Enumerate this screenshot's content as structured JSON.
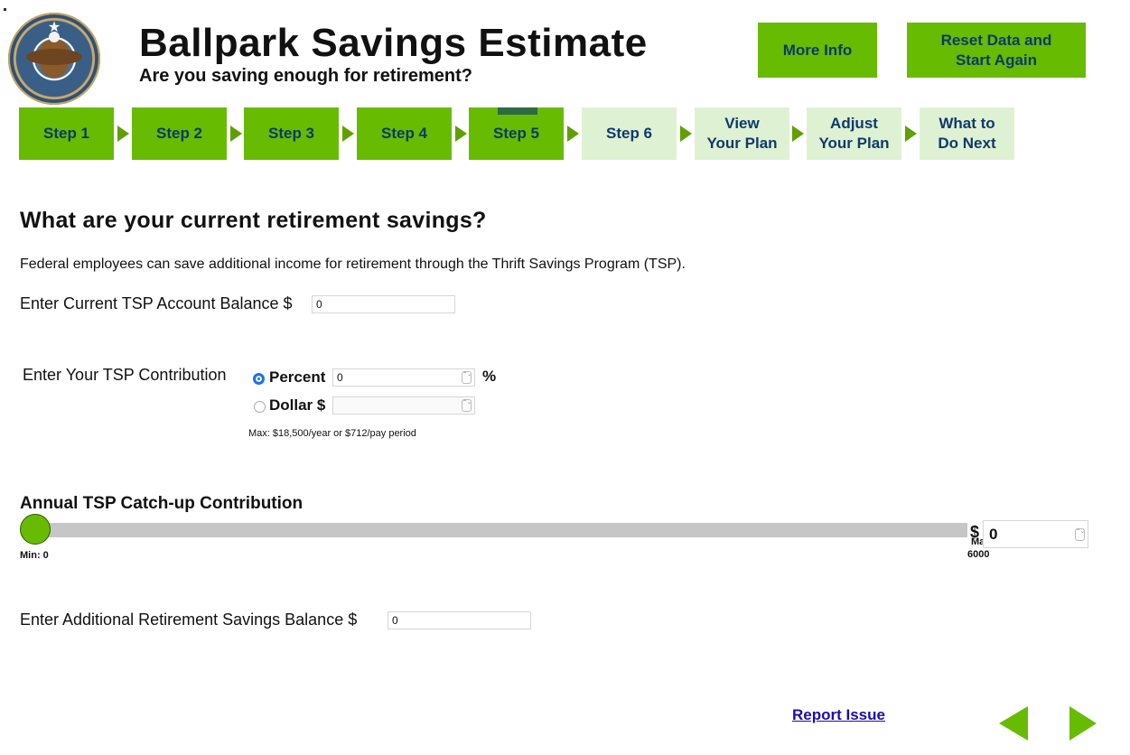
{
  "header": {
    "title": "Ballpark Savings Estimate",
    "subtitle": "Are you saving enough for retirement?",
    "more_info": "More Info",
    "reset": "Reset Data and Start Again"
  },
  "steps": [
    {
      "label": "Step 1",
      "state": "done"
    },
    {
      "label": "Step 2",
      "state": "done"
    },
    {
      "label": "Step 3",
      "state": "done"
    },
    {
      "label": "Step 4",
      "state": "done"
    },
    {
      "label": "Step 5",
      "state": "current"
    },
    {
      "label": "Step 6",
      "state": "todo"
    },
    {
      "label": "View Your Plan",
      "state": "todo"
    },
    {
      "label": "Adjust Your Plan",
      "state": "todo"
    },
    {
      "label": "What to Do Next",
      "state": "todo"
    }
  ],
  "main": {
    "heading": "What are your current retirement savings?",
    "intro": "Federal employees can save additional income for retirement through the Thrift Savings Program (TSP).",
    "tsp_balance_label": "Enter Current TSP Account Balance $",
    "tsp_balance_value": "0",
    "contribution_label": "Enter Your TSP Contribution",
    "percent_label": "Percent",
    "percent_value": "0",
    "percent_unit": "%",
    "dollar_label": "Dollar $",
    "dollar_value": "",
    "max_note": "Max: $18,500/year or $712/pay period",
    "catchup_heading": "Annual TSP Catch-up Contribution",
    "slider_min_label": "Min: 0",
    "slider_max_label": "Max:",
    "slider_max_value": "6000",
    "slider_value_fraction": 0,
    "catchup_currency": "$",
    "catchup_value": "0",
    "additional_label": "Enter Additional Retirement Savings Balance $",
    "additional_value": "0"
  },
  "footer": {
    "report_issue": "Report Issue",
    "prev_icon": "left-arrow-icon",
    "next_icon": "right-arrow-icon"
  },
  "colors": {
    "accent_green": "#67bb00",
    "step_todo": "#dff1d3",
    "text_navy": "#0d3a6b"
  }
}
